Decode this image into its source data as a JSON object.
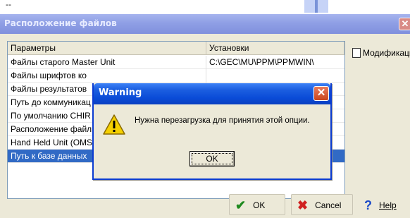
{
  "background": {
    "top_text": "--"
  },
  "window": {
    "title": "Расположение файлов",
    "close_glyph": "✕"
  },
  "list": {
    "headers": [
      "Параметры",
      "Установки"
    ],
    "rows": [
      {
        "param": "Файлы старого Master Unit",
        "setting": "C:\\GEC\\MU\\PPM\\PPMWIN\\"
      },
      {
        "param": "Файлы шрифтов ко",
        "setting": ""
      },
      {
        "param": "Файлы результатов",
        "setting": ""
      },
      {
        "param": "Путь до коммуникац",
        "setting": ""
      },
      {
        "param": "По умолчанию CHIR",
        "setting": ""
      },
      {
        "param": "Расположение файл",
        "setting": ""
      },
      {
        "param": "Hand Held Unit (OMS",
        "setting": ""
      },
      {
        "param": "Путь к базе данных",
        "setting": ""
      }
    ],
    "selected_index": 7
  },
  "side": {
    "modify_label": "Модификаци"
  },
  "buttons": {
    "ok_label": "OK",
    "cancel_label": "Cancel",
    "help_label": "Help",
    "ok_icon": "check-icon",
    "cancel_icon": "x-icon",
    "help_icon": "question-icon"
  },
  "dialog": {
    "title": "Warning",
    "message": "Нужна перезагрузка для принятия этой опции.",
    "ok_label": "OK",
    "icon": "warning-icon",
    "close_glyph": "✕"
  },
  "colors": {
    "selection": "#316ac5",
    "dialog_title": "#0a4bd7",
    "warning_yellow": "#f5d000"
  }
}
